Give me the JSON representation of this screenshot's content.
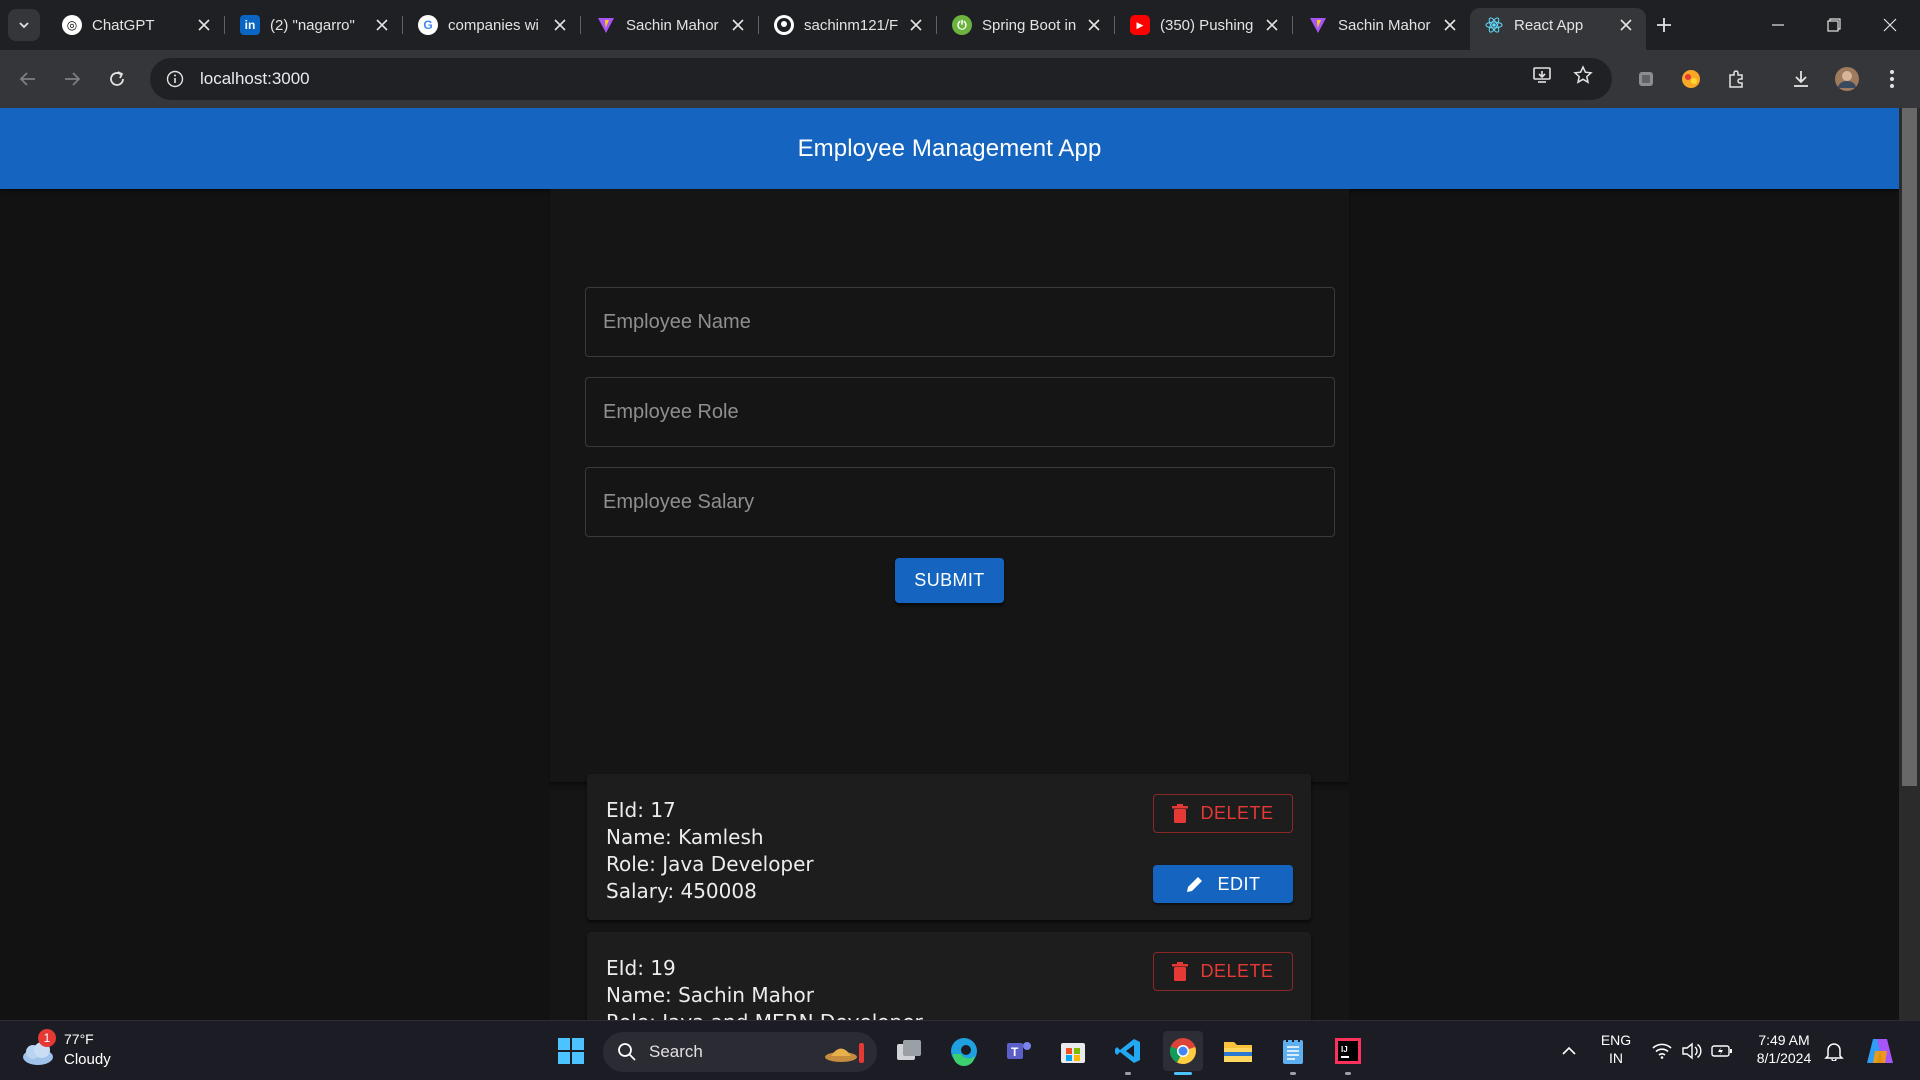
{
  "browser": {
    "tabs": [
      {
        "title": "ChatGPT",
        "icon": "chatgpt-icon"
      },
      {
        "title": "(2) \"nagarro\"",
        "icon": "linkedin-icon"
      },
      {
        "title": "companies wi",
        "icon": "google-icon"
      },
      {
        "title": "Sachin Mahor",
        "icon": "vite-icon"
      },
      {
        "title": "sachinm121/F",
        "icon": "github-icon"
      },
      {
        "title": "Spring Boot in",
        "icon": "spring-icon"
      },
      {
        "title": "(350) Pushing",
        "icon": "youtube-icon"
      },
      {
        "title": "Sachin Mahor",
        "icon": "vite-icon"
      },
      {
        "title": "React App",
        "icon": "react-icon",
        "active": true
      }
    ],
    "url": "localhost:3000"
  },
  "app": {
    "title": "Employee Management App",
    "form": {
      "name_placeholder": "Employee Name",
      "role_placeholder": "Employee Role",
      "salary_placeholder": "Employee Salary",
      "submit_label": "SUBMIT"
    },
    "employees": [
      {
        "eid": "EId: 17",
        "name": "Name: Kamlesh",
        "role": "Role: Java Developer",
        "salary": "Salary: 450008"
      },
      {
        "eid": "EId: 19",
        "name": "Name: Sachin Mahor",
        "role": "Role: Java and MERN Developer",
        "salary": ""
      }
    ],
    "delete_label": "DELETE",
    "edit_label": "EDIT"
  },
  "taskbar": {
    "weather": {
      "temp": "77°F",
      "condition": "Cloudy",
      "badge": "1"
    },
    "search_label": "Search",
    "language": {
      "line1": "ENG",
      "line2": "IN"
    },
    "time": "7:49 AM",
    "date": "8/1/2024"
  },
  "colors": {
    "appbar": "#1565c0",
    "delete": "#e53935",
    "background": "#121212"
  }
}
